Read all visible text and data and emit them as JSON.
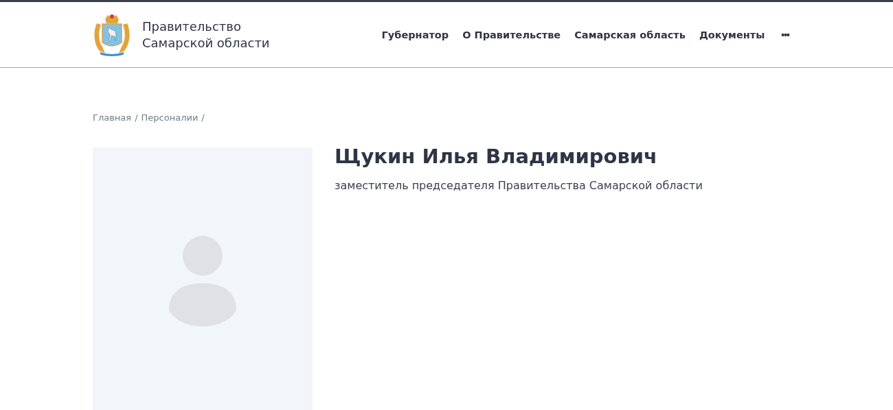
{
  "header": {
    "title_lines": [
      "Правительство",
      "Самарской области"
    ],
    "nav": [
      {
        "label": "Губернатор"
      },
      {
        "label": "О Правительстве"
      },
      {
        "label": "Самарская область"
      },
      {
        "label": "Документы"
      }
    ],
    "more": "•••"
  },
  "breadcrumb": [
    {
      "label": "Главная",
      "separator": "/"
    },
    {
      "label": "Персоналии",
      "separator": "/"
    }
  ],
  "person": {
    "name": "Щукин Илья Владимирович",
    "position": "заместитель председателя Правительства Самарской области",
    "photo": {
      "kind": "placeholder"
    }
  }
}
